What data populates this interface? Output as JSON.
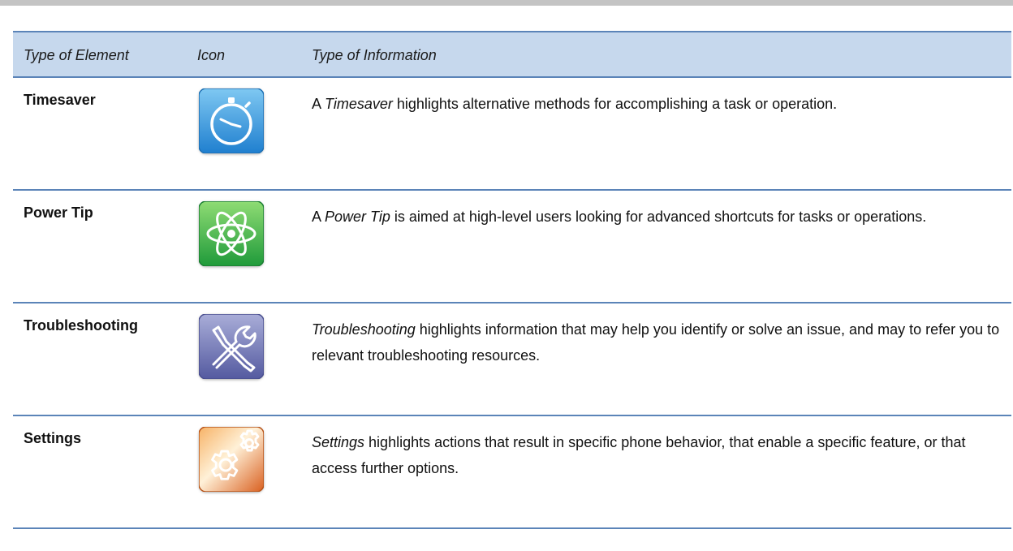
{
  "table": {
    "headers": {
      "element": "Type of Element",
      "icon": "Icon",
      "info": "Type of Information"
    },
    "rows": [
      {
        "name": "Timesaver",
        "icon": "stopwatch-icon",
        "icon_color": "#3a9ad9",
        "desc_lead": "A ",
        "desc_em": "Timesaver",
        "desc_rest": " highlights alternative methods for accomplishing a task or operation."
      },
      {
        "name": "Power Tip",
        "icon": "atom-icon",
        "icon_color": "#3bb14a",
        "desc_lead": "A ",
        "desc_em": "Power Tip",
        "desc_rest": " is aimed at high-level users looking for advanced shortcuts for tasks or operations."
      },
      {
        "name": "Troubleshooting",
        "icon": "tools-icon",
        "icon_color": "#6f74b3",
        "desc_lead": "",
        "desc_em": "Troubleshooting",
        "desc_rest": " highlights information that may help you identify or solve an issue, and may to refer you to relevant troubleshooting resources."
      },
      {
        "name": "Settings",
        "icon": "gears-icon",
        "icon_color": "#e0782a",
        "desc_lead": "",
        "desc_em": "Settings",
        "desc_rest": " highlights actions that result in specific phone behavior, that enable a specific feature, or that access further options."
      }
    ]
  }
}
